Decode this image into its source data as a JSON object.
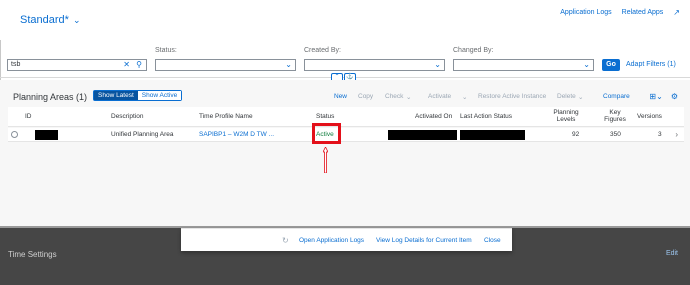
{
  "header": {
    "variant_title": "Standard*",
    "links": [
      "Application Logs",
      "Related Apps"
    ],
    "external_icon": "external-link-icon"
  },
  "filters": {
    "search_value": "tsb",
    "status_label": "Status:",
    "created_by_label": "Created By:",
    "changed_by_label": "Changed By:",
    "go_label": "Go",
    "adapt_label": "Adapt Filters (1)"
  },
  "table": {
    "title": "Planning Areas (1)",
    "toggle": [
      "Show Latest",
      "Show Active"
    ],
    "actions": {
      "new": "New",
      "copy": "Copy",
      "check": "Check",
      "activate": "Activate",
      "restore": "Restore Active Instance",
      "delete": "Delete",
      "compare": "Compare"
    },
    "columns": {
      "id": "ID",
      "description": "Description",
      "time_profile": "Time Profile Name",
      "status": "Status",
      "activated_on": "Activated On",
      "last_action": "Last Action Status",
      "planning_levels": "Planning Levels",
      "key_figures": "Key Figures",
      "versions": "Versions"
    },
    "rows": [
      {
        "description": "Unified Planning Area",
        "time_profile": "SAPIBP1 – W2M D TW ...",
        "status": "Active",
        "planning_levels": "92",
        "key_figures": "350",
        "versions": "3"
      }
    ]
  },
  "dialog": {
    "open_logs": "Open Application Logs",
    "view_details": "View Log Details for Current Item",
    "close": "Close"
  },
  "background": {
    "section_title": "Time Settings",
    "edit": "Edit"
  },
  "colors": {
    "accent": "#0a6ed1",
    "active_status": "#107e3e",
    "highlight": "#e3101a"
  }
}
